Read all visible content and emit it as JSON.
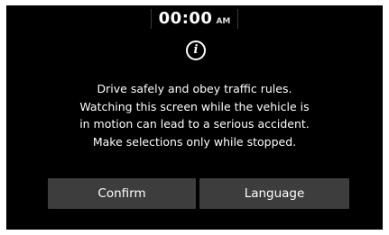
{
  "status_bar": {
    "time": "00:00",
    "ampm": "AM"
  },
  "info_icon_symbol": "i",
  "message": {
    "lines": [
      "Drive safely and obey traffic rules.",
      "Watching this screen while the vehicle is",
      "in motion can lead to a serious accident.",
      "Make selections only while stopped."
    ]
  },
  "buttons": {
    "confirm_label": "Confirm",
    "language_label": "Language"
  },
  "colors": {
    "background": "#000000",
    "text": "#ffffff",
    "button": "#3d3d3d"
  }
}
